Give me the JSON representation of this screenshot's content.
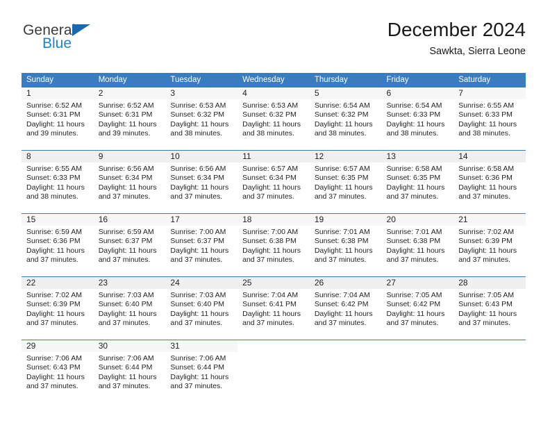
{
  "brand": {
    "name_part1": "General",
    "name_part2": "Blue",
    "triangle_color": "#1769b5",
    "blue_color": "#1c82d4"
  },
  "header": {
    "title": "December 2024",
    "subtitle": "Sawkta, Sierra Leone"
  },
  "theme": {
    "header_bg": "#3a7cc0",
    "header_text": "#ffffff",
    "row_border": "#3a7cc0",
    "daynum_band_bg": "#f7f7f7",
    "daynum_band_bg_alt": "#f0f0f0",
    "cell_text": "#231f20"
  },
  "weekday_headers": [
    "Sunday",
    "Monday",
    "Tuesday",
    "Wednesday",
    "Thursday",
    "Friday",
    "Saturday"
  ],
  "weeks": [
    [
      {
        "day": "1",
        "sunrise": "Sunrise: 6:52 AM",
        "sunset": "Sunset: 6:31 PM",
        "daylight1": "Daylight: 11 hours",
        "daylight2": "and 39 minutes."
      },
      {
        "day": "2",
        "sunrise": "Sunrise: 6:52 AM",
        "sunset": "Sunset: 6:31 PM",
        "daylight1": "Daylight: 11 hours",
        "daylight2": "and 39 minutes."
      },
      {
        "day": "3",
        "sunrise": "Sunrise: 6:53 AM",
        "sunset": "Sunset: 6:32 PM",
        "daylight1": "Daylight: 11 hours",
        "daylight2": "and 38 minutes."
      },
      {
        "day": "4",
        "sunrise": "Sunrise: 6:53 AM",
        "sunset": "Sunset: 6:32 PM",
        "daylight1": "Daylight: 11 hours",
        "daylight2": "and 38 minutes."
      },
      {
        "day": "5",
        "sunrise": "Sunrise: 6:54 AM",
        "sunset": "Sunset: 6:32 PM",
        "daylight1": "Daylight: 11 hours",
        "daylight2": "and 38 minutes."
      },
      {
        "day": "6",
        "sunrise": "Sunrise: 6:54 AM",
        "sunset": "Sunset: 6:33 PM",
        "daylight1": "Daylight: 11 hours",
        "daylight2": "and 38 minutes."
      },
      {
        "day": "7",
        "sunrise": "Sunrise: 6:55 AM",
        "sunset": "Sunset: 6:33 PM",
        "daylight1": "Daylight: 11 hours",
        "daylight2": "and 38 minutes."
      }
    ],
    [
      {
        "day": "8",
        "sunrise": "Sunrise: 6:55 AM",
        "sunset": "Sunset: 6:33 PM",
        "daylight1": "Daylight: 11 hours",
        "daylight2": "and 38 minutes."
      },
      {
        "day": "9",
        "sunrise": "Sunrise: 6:56 AM",
        "sunset": "Sunset: 6:34 PM",
        "daylight1": "Daylight: 11 hours",
        "daylight2": "and 37 minutes."
      },
      {
        "day": "10",
        "sunrise": "Sunrise: 6:56 AM",
        "sunset": "Sunset: 6:34 PM",
        "daylight1": "Daylight: 11 hours",
        "daylight2": "and 37 minutes."
      },
      {
        "day": "11",
        "sunrise": "Sunrise: 6:57 AM",
        "sunset": "Sunset: 6:34 PM",
        "daylight1": "Daylight: 11 hours",
        "daylight2": "and 37 minutes."
      },
      {
        "day": "12",
        "sunrise": "Sunrise: 6:57 AM",
        "sunset": "Sunset: 6:35 PM",
        "daylight1": "Daylight: 11 hours",
        "daylight2": "and 37 minutes."
      },
      {
        "day": "13",
        "sunrise": "Sunrise: 6:58 AM",
        "sunset": "Sunset: 6:35 PM",
        "daylight1": "Daylight: 11 hours",
        "daylight2": "and 37 minutes."
      },
      {
        "day": "14",
        "sunrise": "Sunrise: 6:58 AM",
        "sunset": "Sunset: 6:36 PM",
        "daylight1": "Daylight: 11 hours",
        "daylight2": "and 37 minutes."
      }
    ],
    [
      {
        "day": "15",
        "sunrise": "Sunrise: 6:59 AM",
        "sunset": "Sunset: 6:36 PM",
        "daylight1": "Daylight: 11 hours",
        "daylight2": "and 37 minutes."
      },
      {
        "day": "16",
        "sunrise": "Sunrise: 6:59 AM",
        "sunset": "Sunset: 6:37 PM",
        "daylight1": "Daylight: 11 hours",
        "daylight2": "and 37 minutes."
      },
      {
        "day": "17",
        "sunrise": "Sunrise: 7:00 AM",
        "sunset": "Sunset: 6:37 PM",
        "daylight1": "Daylight: 11 hours",
        "daylight2": "and 37 minutes."
      },
      {
        "day": "18",
        "sunrise": "Sunrise: 7:00 AM",
        "sunset": "Sunset: 6:38 PM",
        "daylight1": "Daylight: 11 hours",
        "daylight2": "and 37 minutes."
      },
      {
        "day": "19",
        "sunrise": "Sunrise: 7:01 AM",
        "sunset": "Sunset: 6:38 PM",
        "daylight1": "Daylight: 11 hours",
        "daylight2": "and 37 minutes."
      },
      {
        "day": "20",
        "sunrise": "Sunrise: 7:01 AM",
        "sunset": "Sunset: 6:38 PM",
        "daylight1": "Daylight: 11 hours",
        "daylight2": "and 37 minutes."
      },
      {
        "day": "21",
        "sunrise": "Sunrise: 7:02 AM",
        "sunset": "Sunset: 6:39 PM",
        "daylight1": "Daylight: 11 hours",
        "daylight2": "and 37 minutes."
      }
    ],
    [
      {
        "day": "22",
        "sunrise": "Sunrise: 7:02 AM",
        "sunset": "Sunset: 6:39 PM",
        "daylight1": "Daylight: 11 hours",
        "daylight2": "and 37 minutes."
      },
      {
        "day": "23",
        "sunrise": "Sunrise: 7:03 AM",
        "sunset": "Sunset: 6:40 PM",
        "daylight1": "Daylight: 11 hours",
        "daylight2": "and 37 minutes."
      },
      {
        "day": "24",
        "sunrise": "Sunrise: 7:03 AM",
        "sunset": "Sunset: 6:40 PM",
        "daylight1": "Daylight: 11 hours",
        "daylight2": "and 37 minutes."
      },
      {
        "day": "25",
        "sunrise": "Sunrise: 7:04 AM",
        "sunset": "Sunset: 6:41 PM",
        "daylight1": "Daylight: 11 hours",
        "daylight2": "and 37 minutes."
      },
      {
        "day": "26",
        "sunrise": "Sunrise: 7:04 AM",
        "sunset": "Sunset: 6:42 PM",
        "daylight1": "Daylight: 11 hours",
        "daylight2": "and 37 minutes."
      },
      {
        "day": "27",
        "sunrise": "Sunrise: 7:05 AM",
        "sunset": "Sunset: 6:42 PM",
        "daylight1": "Daylight: 11 hours",
        "daylight2": "and 37 minutes."
      },
      {
        "day": "28",
        "sunrise": "Sunrise: 7:05 AM",
        "sunset": "Sunset: 6:43 PM",
        "daylight1": "Daylight: 11 hours",
        "daylight2": "and 37 minutes."
      }
    ],
    [
      {
        "day": "29",
        "sunrise": "Sunrise: 7:06 AM",
        "sunset": "Sunset: 6:43 PM",
        "daylight1": "Daylight: 11 hours",
        "daylight2": "and 37 minutes."
      },
      {
        "day": "30",
        "sunrise": "Sunrise: 7:06 AM",
        "sunset": "Sunset: 6:44 PM",
        "daylight1": "Daylight: 11 hours",
        "daylight2": "and 37 minutes."
      },
      {
        "day": "31",
        "sunrise": "Sunrise: 7:06 AM",
        "sunset": "Sunset: 6:44 PM",
        "daylight1": "Daylight: 11 hours",
        "daylight2": "and 37 minutes."
      },
      {
        "day": "",
        "sunrise": "",
        "sunset": "",
        "daylight1": "",
        "daylight2": ""
      },
      {
        "day": "",
        "sunrise": "",
        "sunset": "",
        "daylight1": "",
        "daylight2": ""
      },
      {
        "day": "",
        "sunrise": "",
        "sunset": "",
        "daylight1": "",
        "daylight2": ""
      },
      {
        "day": "",
        "sunrise": "",
        "sunset": "",
        "daylight1": "",
        "daylight2": ""
      }
    ]
  ]
}
